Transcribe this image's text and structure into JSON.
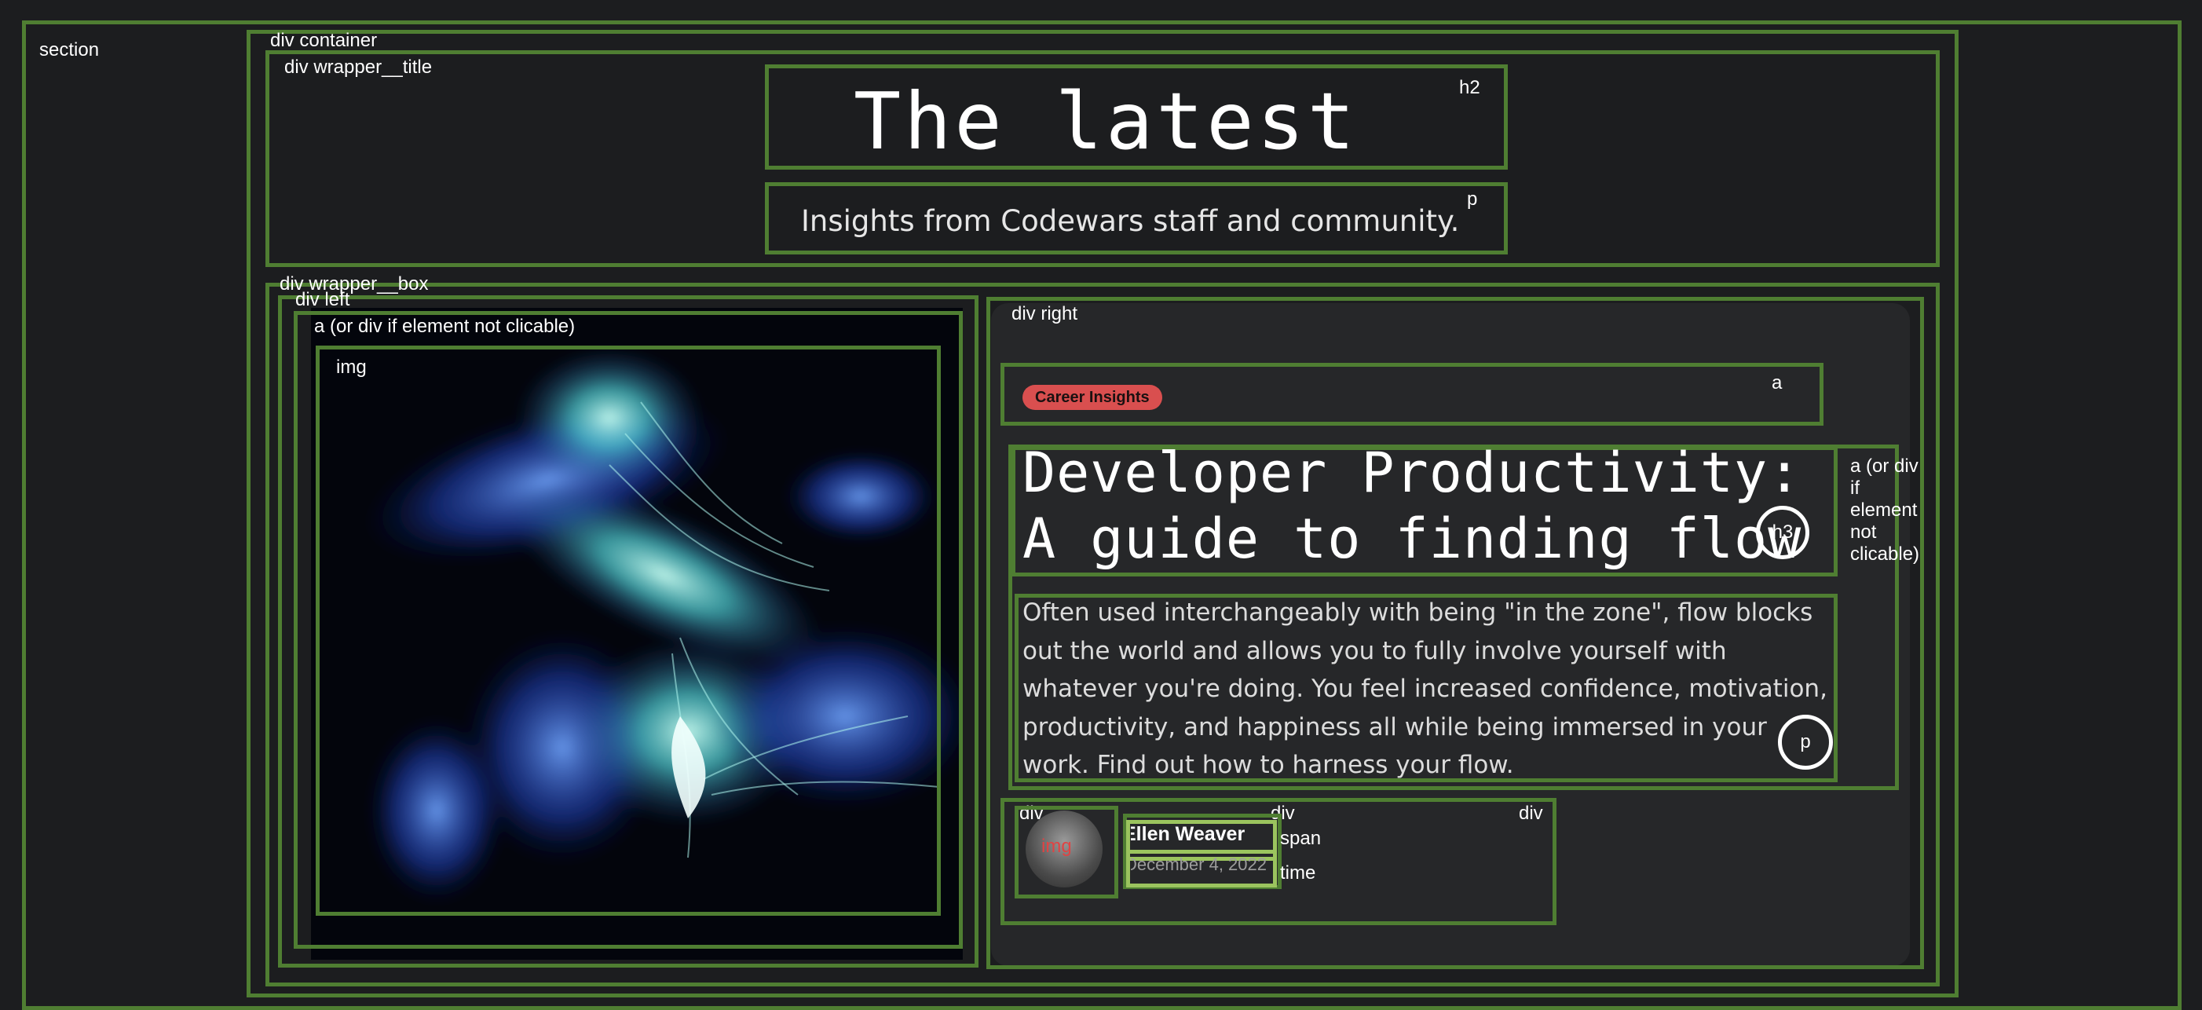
{
  "labels": {
    "section": "section",
    "container": "div container",
    "wrapper_title": "div wrapper__title",
    "h2": "h2",
    "p": "p",
    "wrapper_box": "div wrapper__box",
    "left": "div left",
    "a_link": "a (or div if element not clicable)",
    "img": "img",
    "right": "div right",
    "a": "a",
    "a_side": [
      "a (or div",
      "if",
      "element",
      "not",
      "clicable)"
    ],
    "h3": "h3",
    "p2": "p",
    "div1": "div",
    "div2": "div",
    "div3": "div",
    "span": "span",
    "time": "time",
    "avatar_img": "img"
  },
  "heading": {
    "title": "The latest",
    "subtitle": "Insights from Codewars staff and community."
  },
  "article": {
    "category": "Career Insights",
    "title": "Developer Productivity: A guide to finding flow",
    "excerpt": "Often used interchangeably with being \"in the zone\", flow blocks out the world and allows you to fully involve yourself with whatever you're doing. You feel increased confidence, motivation, productivity, and happiness all while being immersed in your work. Find out how to harness your flow.",
    "author": "Ellen Weaver",
    "date": "December 4, 2022"
  },
  "colors": {
    "background": "#1c1d1f",
    "outline": "#4f7e32",
    "badge": "#d94f4f",
    "card": "#262729"
  }
}
